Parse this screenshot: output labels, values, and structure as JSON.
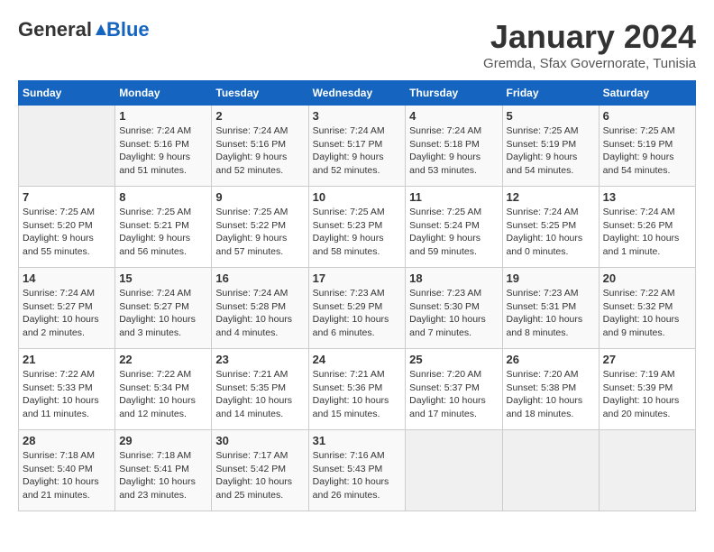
{
  "header": {
    "logo_general": "General",
    "logo_blue": "Blue",
    "month_title": "January 2024",
    "location": "Gremda, Sfax Governorate, Tunisia"
  },
  "weekdays": [
    "Sunday",
    "Monday",
    "Tuesday",
    "Wednesday",
    "Thursday",
    "Friday",
    "Saturday"
  ],
  "weeks": [
    [
      {
        "day": "",
        "sunrise": "",
        "sunset": "",
        "daylight": ""
      },
      {
        "day": "1",
        "sunrise": "Sunrise: 7:24 AM",
        "sunset": "Sunset: 5:16 PM",
        "daylight": "Daylight: 9 hours and 51 minutes."
      },
      {
        "day": "2",
        "sunrise": "Sunrise: 7:24 AM",
        "sunset": "Sunset: 5:16 PM",
        "daylight": "Daylight: 9 hours and 52 minutes."
      },
      {
        "day": "3",
        "sunrise": "Sunrise: 7:24 AM",
        "sunset": "Sunset: 5:17 PM",
        "daylight": "Daylight: 9 hours and 52 minutes."
      },
      {
        "day": "4",
        "sunrise": "Sunrise: 7:24 AM",
        "sunset": "Sunset: 5:18 PM",
        "daylight": "Daylight: 9 hours and 53 minutes."
      },
      {
        "day": "5",
        "sunrise": "Sunrise: 7:25 AM",
        "sunset": "Sunset: 5:19 PM",
        "daylight": "Daylight: 9 hours and 54 minutes."
      },
      {
        "day": "6",
        "sunrise": "Sunrise: 7:25 AM",
        "sunset": "Sunset: 5:19 PM",
        "daylight": "Daylight: 9 hours and 54 minutes."
      }
    ],
    [
      {
        "day": "7",
        "sunrise": "Sunrise: 7:25 AM",
        "sunset": "Sunset: 5:20 PM",
        "daylight": "Daylight: 9 hours and 55 minutes."
      },
      {
        "day": "8",
        "sunrise": "Sunrise: 7:25 AM",
        "sunset": "Sunset: 5:21 PM",
        "daylight": "Daylight: 9 hours and 56 minutes."
      },
      {
        "day": "9",
        "sunrise": "Sunrise: 7:25 AM",
        "sunset": "Sunset: 5:22 PM",
        "daylight": "Daylight: 9 hours and 57 minutes."
      },
      {
        "day": "10",
        "sunrise": "Sunrise: 7:25 AM",
        "sunset": "Sunset: 5:23 PM",
        "daylight": "Daylight: 9 hours and 58 minutes."
      },
      {
        "day": "11",
        "sunrise": "Sunrise: 7:25 AM",
        "sunset": "Sunset: 5:24 PM",
        "daylight": "Daylight: 9 hours and 59 minutes."
      },
      {
        "day": "12",
        "sunrise": "Sunrise: 7:24 AM",
        "sunset": "Sunset: 5:25 PM",
        "daylight": "Daylight: 10 hours and 0 minutes."
      },
      {
        "day": "13",
        "sunrise": "Sunrise: 7:24 AM",
        "sunset": "Sunset: 5:26 PM",
        "daylight": "Daylight: 10 hours and 1 minute."
      }
    ],
    [
      {
        "day": "14",
        "sunrise": "Sunrise: 7:24 AM",
        "sunset": "Sunset: 5:27 PM",
        "daylight": "Daylight: 10 hours and 2 minutes."
      },
      {
        "day": "15",
        "sunrise": "Sunrise: 7:24 AM",
        "sunset": "Sunset: 5:27 PM",
        "daylight": "Daylight: 10 hours and 3 minutes."
      },
      {
        "day": "16",
        "sunrise": "Sunrise: 7:24 AM",
        "sunset": "Sunset: 5:28 PM",
        "daylight": "Daylight: 10 hours and 4 minutes."
      },
      {
        "day": "17",
        "sunrise": "Sunrise: 7:23 AM",
        "sunset": "Sunset: 5:29 PM",
        "daylight": "Daylight: 10 hours and 6 minutes."
      },
      {
        "day": "18",
        "sunrise": "Sunrise: 7:23 AM",
        "sunset": "Sunset: 5:30 PM",
        "daylight": "Daylight: 10 hours and 7 minutes."
      },
      {
        "day": "19",
        "sunrise": "Sunrise: 7:23 AM",
        "sunset": "Sunset: 5:31 PM",
        "daylight": "Daylight: 10 hours and 8 minutes."
      },
      {
        "day": "20",
        "sunrise": "Sunrise: 7:22 AM",
        "sunset": "Sunset: 5:32 PM",
        "daylight": "Daylight: 10 hours and 9 minutes."
      }
    ],
    [
      {
        "day": "21",
        "sunrise": "Sunrise: 7:22 AM",
        "sunset": "Sunset: 5:33 PM",
        "daylight": "Daylight: 10 hours and 11 minutes."
      },
      {
        "day": "22",
        "sunrise": "Sunrise: 7:22 AM",
        "sunset": "Sunset: 5:34 PM",
        "daylight": "Daylight: 10 hours and 12 minutes."
      },
      {
        "day": "23",
        "sunrise": "Sunrise: 7:21 AM",
        "sunset": "Sunset: 5:35 PM",
        "daylight": "Daylight: 10 hours and 14 minutes."
      },
      {
        "day": "24",
        "sunrise": "Sunrise: 7:21 AM",
        "sunset": "Sunset: 5:36 PM",
        "daylight": "Daylight: 10 hours and 15 minutes."
      },
      {
        "day": "25",
        "sunrise": "Sunrise: 7:20 AM",
        "sunset": "Sunset: 5:37 PM",
        "daylight": "Daylight: 10 hours and 17 minutes."
      },
      {
        "day": "26",
        "sunrise": "Sunrise: 7:20 AM",
        "sunset": "Sunset: 5:38 PM",
        "daylight": "Daylight: 10 hours and 18 minutes."
      },
      {
        "day": "27",
        "sunrise": "Sunrise: 7:19 AM",
        "sunset": "Sunset: 5:39 PM",
        "daylight": "Daylight: 10 hours and 20 minutes."
      }
    ],
    [
      {
        "day": "28",
        "sunrise": "Sunrise: 7:18 AM",
        "sunset": "Sunset: 5:40 PM",
        "daylight": "Daylight: 10 hours and 21 minutes."
      },
      {
        "day": "29",
        "sunrise": "Sunrise: 7:18 AM",
        "sunset": "Sunset: 5:41 PM",
        "daylight": "Daylight: 10 hours and 23 minutes."
      },
      {
        "day": "30",
        "sunrise": "Sunrise: 7:17 AM",
        "sunset": "Sunset: 5:42 PM",
        "daylight": "Daylight: 10 hours and 25 minutes."
      },
      {
        "day": "31",
        "sunrise": "Sunrise: 7:16 AM",
        "sunset": "Sunset: 5:43 PM",
        "daylight": "Daylight: 10 hours and 26 minutes."
      },
      {
        "day": "",
        "sunrise": "",
        "sunset": "",
        "daylight": ""
      },
      {
        "day": "",
        "sunrise": "",
        "sunset": "",
        "daylight": ""
      },
      {
        "day": "",
        "sunrise": "",
        "sunset": "",
        "daylight": ""
      }
    ]
  ]
}
